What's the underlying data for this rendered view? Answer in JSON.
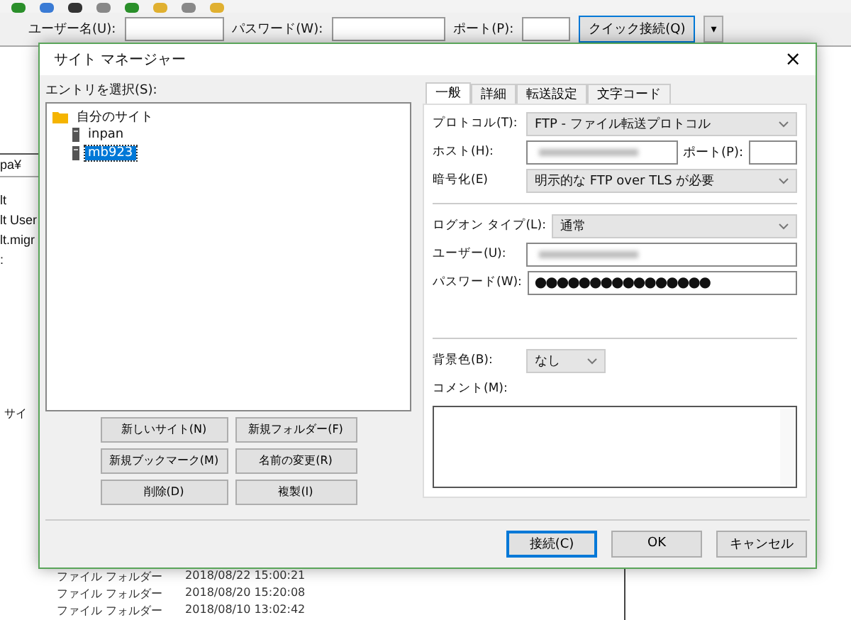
{
  "quickconnect": {
    "fields": [
      {
        "label": "ユーザー名(U):"
      },
      {
        "label": "パスワード(W):"
      },
      {
        "label": "ポート(P):"
      }
    ],
    "button": "クイック接続(Q)",
    "dropdown": "▾"
  },
  "local_panel": {
    "path": "pa¥",
    "items": [
      "lt",
      "lt User",
      "lt.migr",
      ":"
    ],
    "status": "サイ"
  },
  "file_rows": [
    {
      "type": "ファイル フォルダー",
      "date": "2018/08/22 15:00:21"
    },
    {
      "type": "ファイル フォルダー",
      "date": "2018/08/20 15:20:08"
    },
    {
      "type": "ファイル フォルダー",
      "date": "2018/08/10 13:02:42"
    }
  ],
  "dialog": {
    "title": "サイト マネージャー",
    "close": "×",
    "tree_label": "エントリを選択(S):",
    "tree": [
      {
        "label": "自分のサイト",
        "kind": "folder",
        "selected": false,
        "children": [
          {
            "label": "inpan",
            "kind": "server",
            "selected": false
          },
          {
            "label": "mb923",
            "kind": "server",
            "selected": true
          }
        ]
      }
    ],
    "site_buttons": [
      "新しいサイト(N)",
      "新規フォルダー(F)",
      "新規ブックマーク(M)",
      "名前の変更(R)",
      "削除(D)",
      "複製(I)"
    ],
    "tabs": [
      {
        "label": "一般",
        "selected": true
      },
      {
        "label": "詳細",
        "selected": false
      },
      {
        "label": "転送設定",
        "selected": false
      },
      {
        "label": "文字コード",
        "selected": false
      }
    ],
    "protocol": {
      "label": "プロトコル(T):",
      "value": "FTP - ファイル転送プロトコル"
    },
    "host": {
      "label": "ホスト(H):",
      "port_label": "ポート(P):"
    },
    "encryption": {
      "label": "暗号化(E)",
      "value": "明示的な FTP over TLS が必要"
    },
    "logon_type": {
      "label": "ログオン タイプ(L):",
      "value": "通常"
    },
    "user": {
      "label": "ユーザー(U):"
    },
    "password": {
      "label": "パスワード(W):",
      "value": "●●●●●●●●●●●●●●●●"
    },
    "background_color": {
      "label": "背景色(B):",
      "value": "なし"
    },
    "comment": {
      "label": "コメント(M):"
    },
    "footer_buttons": [
      {
        "label": "接続(C)",
        "default": true
      },
      {
        "label": "OK",
        "default": false
      },
      {
        "label": "キャンセル",
        "default": false
      }
    ]
  }
}
